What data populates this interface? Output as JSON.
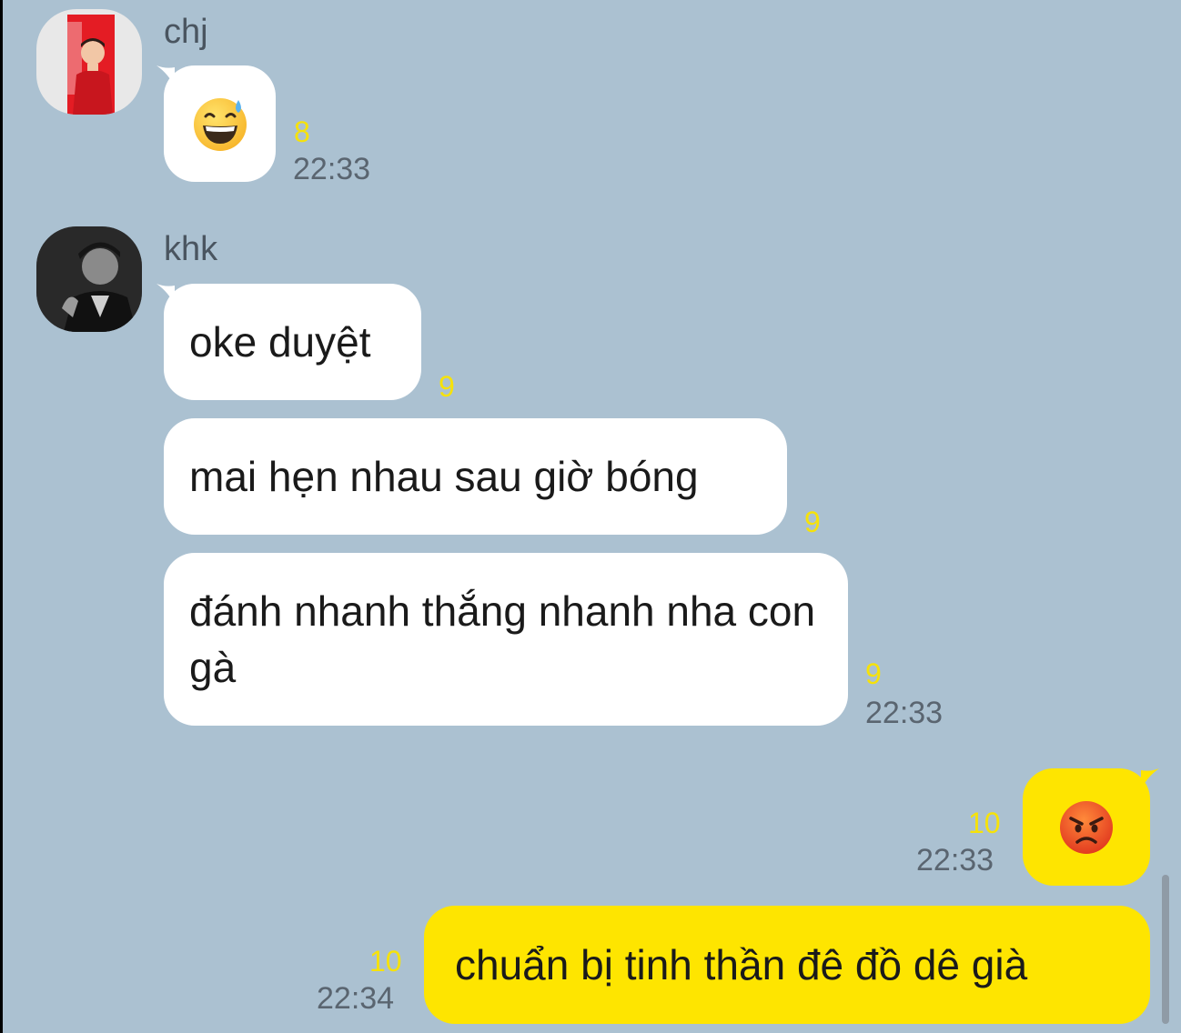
{
  "messages": [
    {
      "sender": "chj",
      "type": "emoji",
      "emoji_name": "grinning-sweat-emoji",
      "unread": "8",
      "time": "22:33"
    },
    {
      "sender": "khk",
      "type": "text",
      "text": "oke duyệt",
      "unread": "9"
    },
    {
      "type": "text",
      "text": "mai hẹn nhau sau giờ bóng",
      "unread": "9"
    },
    {
      "type": "text",
      "text": "đánh nhanh thắng nhanh nha con gà",
      "unread": "9",
      "time": "22:33"
    },
    {
      "type": "emoji",
      "emoji_name": "angry-face-emoji",
      "unread": "10",
      "time": "22:33",
      "outgoing": true
    },
    {
      "type": "text",
      "text": "chuẩn bị tinh thần đê đồ dê già",
      "unread": "10",
      "time": "22:34",
      "outgoing": true
    }
  ],
  "colors": {
    "background": "#abc1d1",
    "incoming_bubble": "#ffffff",
    "outgoing_bubble": "#fee500",
    "unread_count": "#f6e20a",
    "timestamp": "#5a6570"
  }
}
